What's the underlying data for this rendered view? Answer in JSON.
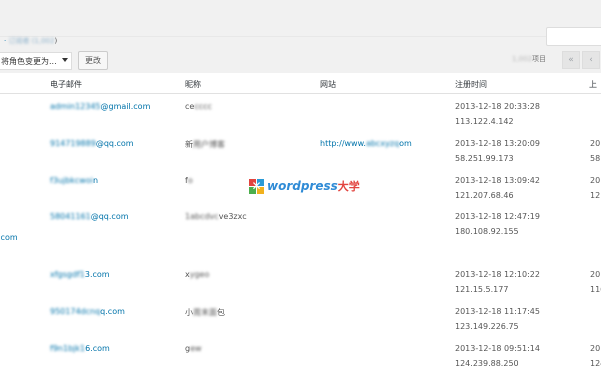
{
  "filter": {
    "prefix": "· ",
    "label": "订阅者",
    "count": "(1,002",
    "close": ")"
  },
  "bulk": {
    "role_select_label": "将角色变更为...",
    "change_button": "更改"
  },
  "pagination": {
    "count_text": "1,002",
    "items_label": "项目",
    "first": "«",
    "prev": "‹"
  },
  "columns": {
    "email": "电子邮件",
    "nickname": "昵称",
    "website": "网站",
    "registered": "注册时间",
    "last": "上"
  },
  "rows": [
    {
      "email_blur": "admin12345",
      "email_visible": "@gmail.com",
      "nick_blur": "ce",
      "nick_visible": "",
      "nick_blur2": "cccc",
      "website_prefix": "",
      "website_blur": "",
      "website_suffix": "",
      "reg_time": "2013-12-18 20:33:28",
      "reg_ip": "113.122.4.142",
      "cut1": "",
      "cut2": ""
    },
    {
      "email_blur": "914719889",
      "email_visible": "@qq.com",
      "nick_blur": "新",
      "nick_visible": "",
      "nick_blur2": "用户博客",
      "website_prefix": "http://www.",
      "website_blur": "abcxyzq",
      "website_suffix": "om",
      "reg_time": "2013-12-18 13:20:09",
      "reg_ip": "58.251.99.173",
      "cut1": "201",
      "cut2": "58."
    },
    {
      "email_blur": "f3ujbkcwoi",
      "email_visible": "n",
      "nick_blur": "f",
      "nick_visible": "",
      "nick_blur2": "o",
      "website_prefix": "",
      "website_blur": "",
      "website_suffix": "",
      "reg_time": "2013-12-18 13:09:42",
      "reg_ip": "121.207.68.46",
      "cut1": "201",
      "cut2": "121"
    },
    {
      "email_blur": "58041161",
      "email_visible": "@qq.com",
      "nick_blur": "1abcdvc",
      "nick_visible": "ve3zxc",
      "nick_blur2": "",
      "website_prefix": "",
      "website_blur": "",
      "website_suffix": "",
      "reg_time": "2013-12-18 12:47:19",
      "reg_ip": "180.108.92.155",
      "cut1": "",
      "cut2": ""
    },
    {
      "email_blur": "xfgsgdf1",
      "email_visible": "3.com",
      "nick_blur": "x",
      "nick_visible": "",
      "nick_blur2": "ygeo",
      "website_prefix": "",
      "website_blur": "",
      "website_suffix": "",
      "reg_time": "2013-12-18 12:10:22",
      "reg_ip": "121.15.5.177",
      "cut1": "201",
      "cut2": "116"
    },
    {
      "email_blur": "950174dcnq",
      "email_visible": "q.com",
      "nick_blur": "小",
      "nick_visible": "包",
      "nick_blur2": "周末面",
      "website_prefix": "",
      "website_blur": "",
      "website_suffix": "",
      "reg_time": "2013-12-18 11:17:45",
      "reg_ip": "123.149.226.75",
      "cut1": "",
      "cut2": ""
    },
    {
      "email_blur": "f9n1bjk1",
      "email_visible": "6.com",
      "nick_blur": "g",
      "nick_visible": "",
      "nick_blur2": "ew",
      "website_prefix": "",
      "website_blur": "",
      "website_suffix": "",
      "reg_time": "2013-12-18 09:51:14",
      "reg_ip": "124.239.88.250",
      "cut1": "201",
      "cut2": "124"
    }
  ],
  "side_email": ".com",
  "watermark": {
    "text": "wordpress",
    "cn": "大学"
  }
}
